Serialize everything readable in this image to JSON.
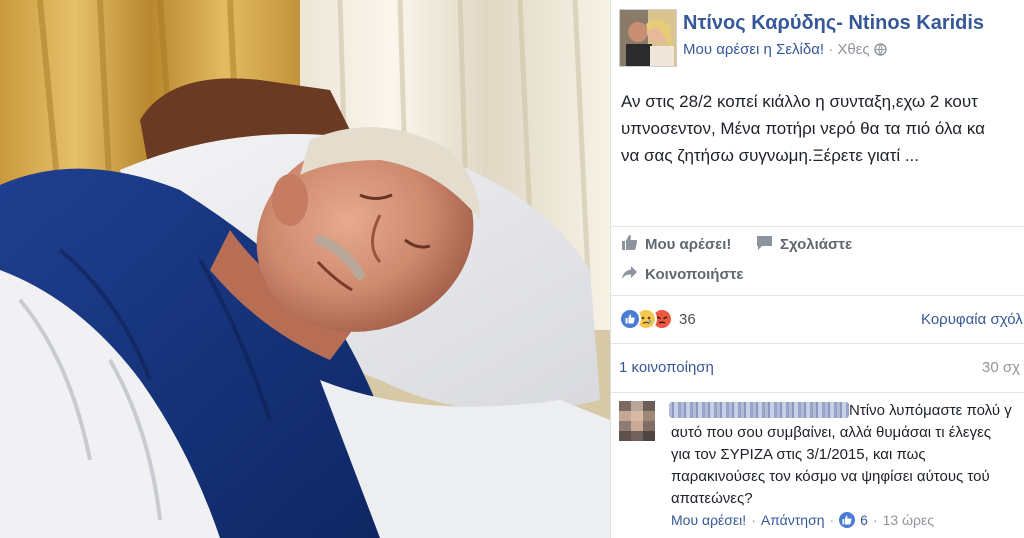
{
  "post": {
    "author": "Ντίνος Καρύδης- Ntinos Karidis",
    "page_like": "Μου αρέσει η Σελίδα!",
    "meta_sep": " · ",
    "time": "Χθες",
    "privacy_icon": "globe-icon",
    "text_lines": [
      "Αν στις 28/2 κοπεί κιάλλο η συνταξη,εχω 2 κουτ",
      "υπνοσεντον, Μένα ποτήρι νερό θα τα πιό όλα κα",
      "να σας ζητήσω συγνωμη.Ξέρετε γιατί ..."
    ]
  },
  "actions": {
    "like": "Μου αρέσει!",
    "comment": "Σχολιάστε",
    "share": "Κοινοποιήστε"
  },
  "reactions": {
    "icons": [
      "like-icon",
      "sad-icon",
      "angry-icon"
    ],
    "count": "36",
    "top_comments": "Κορυφαία σχόλ"
  },
  "stats": {
    "shares": "1 κοινοποίηση",
    "comments": "30 σχ"
  },
  "comment": {
    "lines": [
      "Ντίνο λυπόμαστε πολύ γ",
      "αυτό που σου συμβαίνει, αλλά θυμάσαι τι έλεγες",
      "για τον ΣΥΡΙΖΑ στις 3/1/2015, και πως",
      "παρακινούσες τον κόσμο να ψηφίσει αύτους τού",
      "απατεώνες?"
    ],
    "like": "Μου αρέσει!",
    "reply": "Απάντηση",
    "dot": "·",
    "like_count": "6",
    "time": "13 ώρες"
  },
  "colors": {
    "link": "#365899",
    "like_blue": "#4a7cd5",
    "sad_yellow": "#f7c750",
    "angry_red": "#e9593f"
  }
}
